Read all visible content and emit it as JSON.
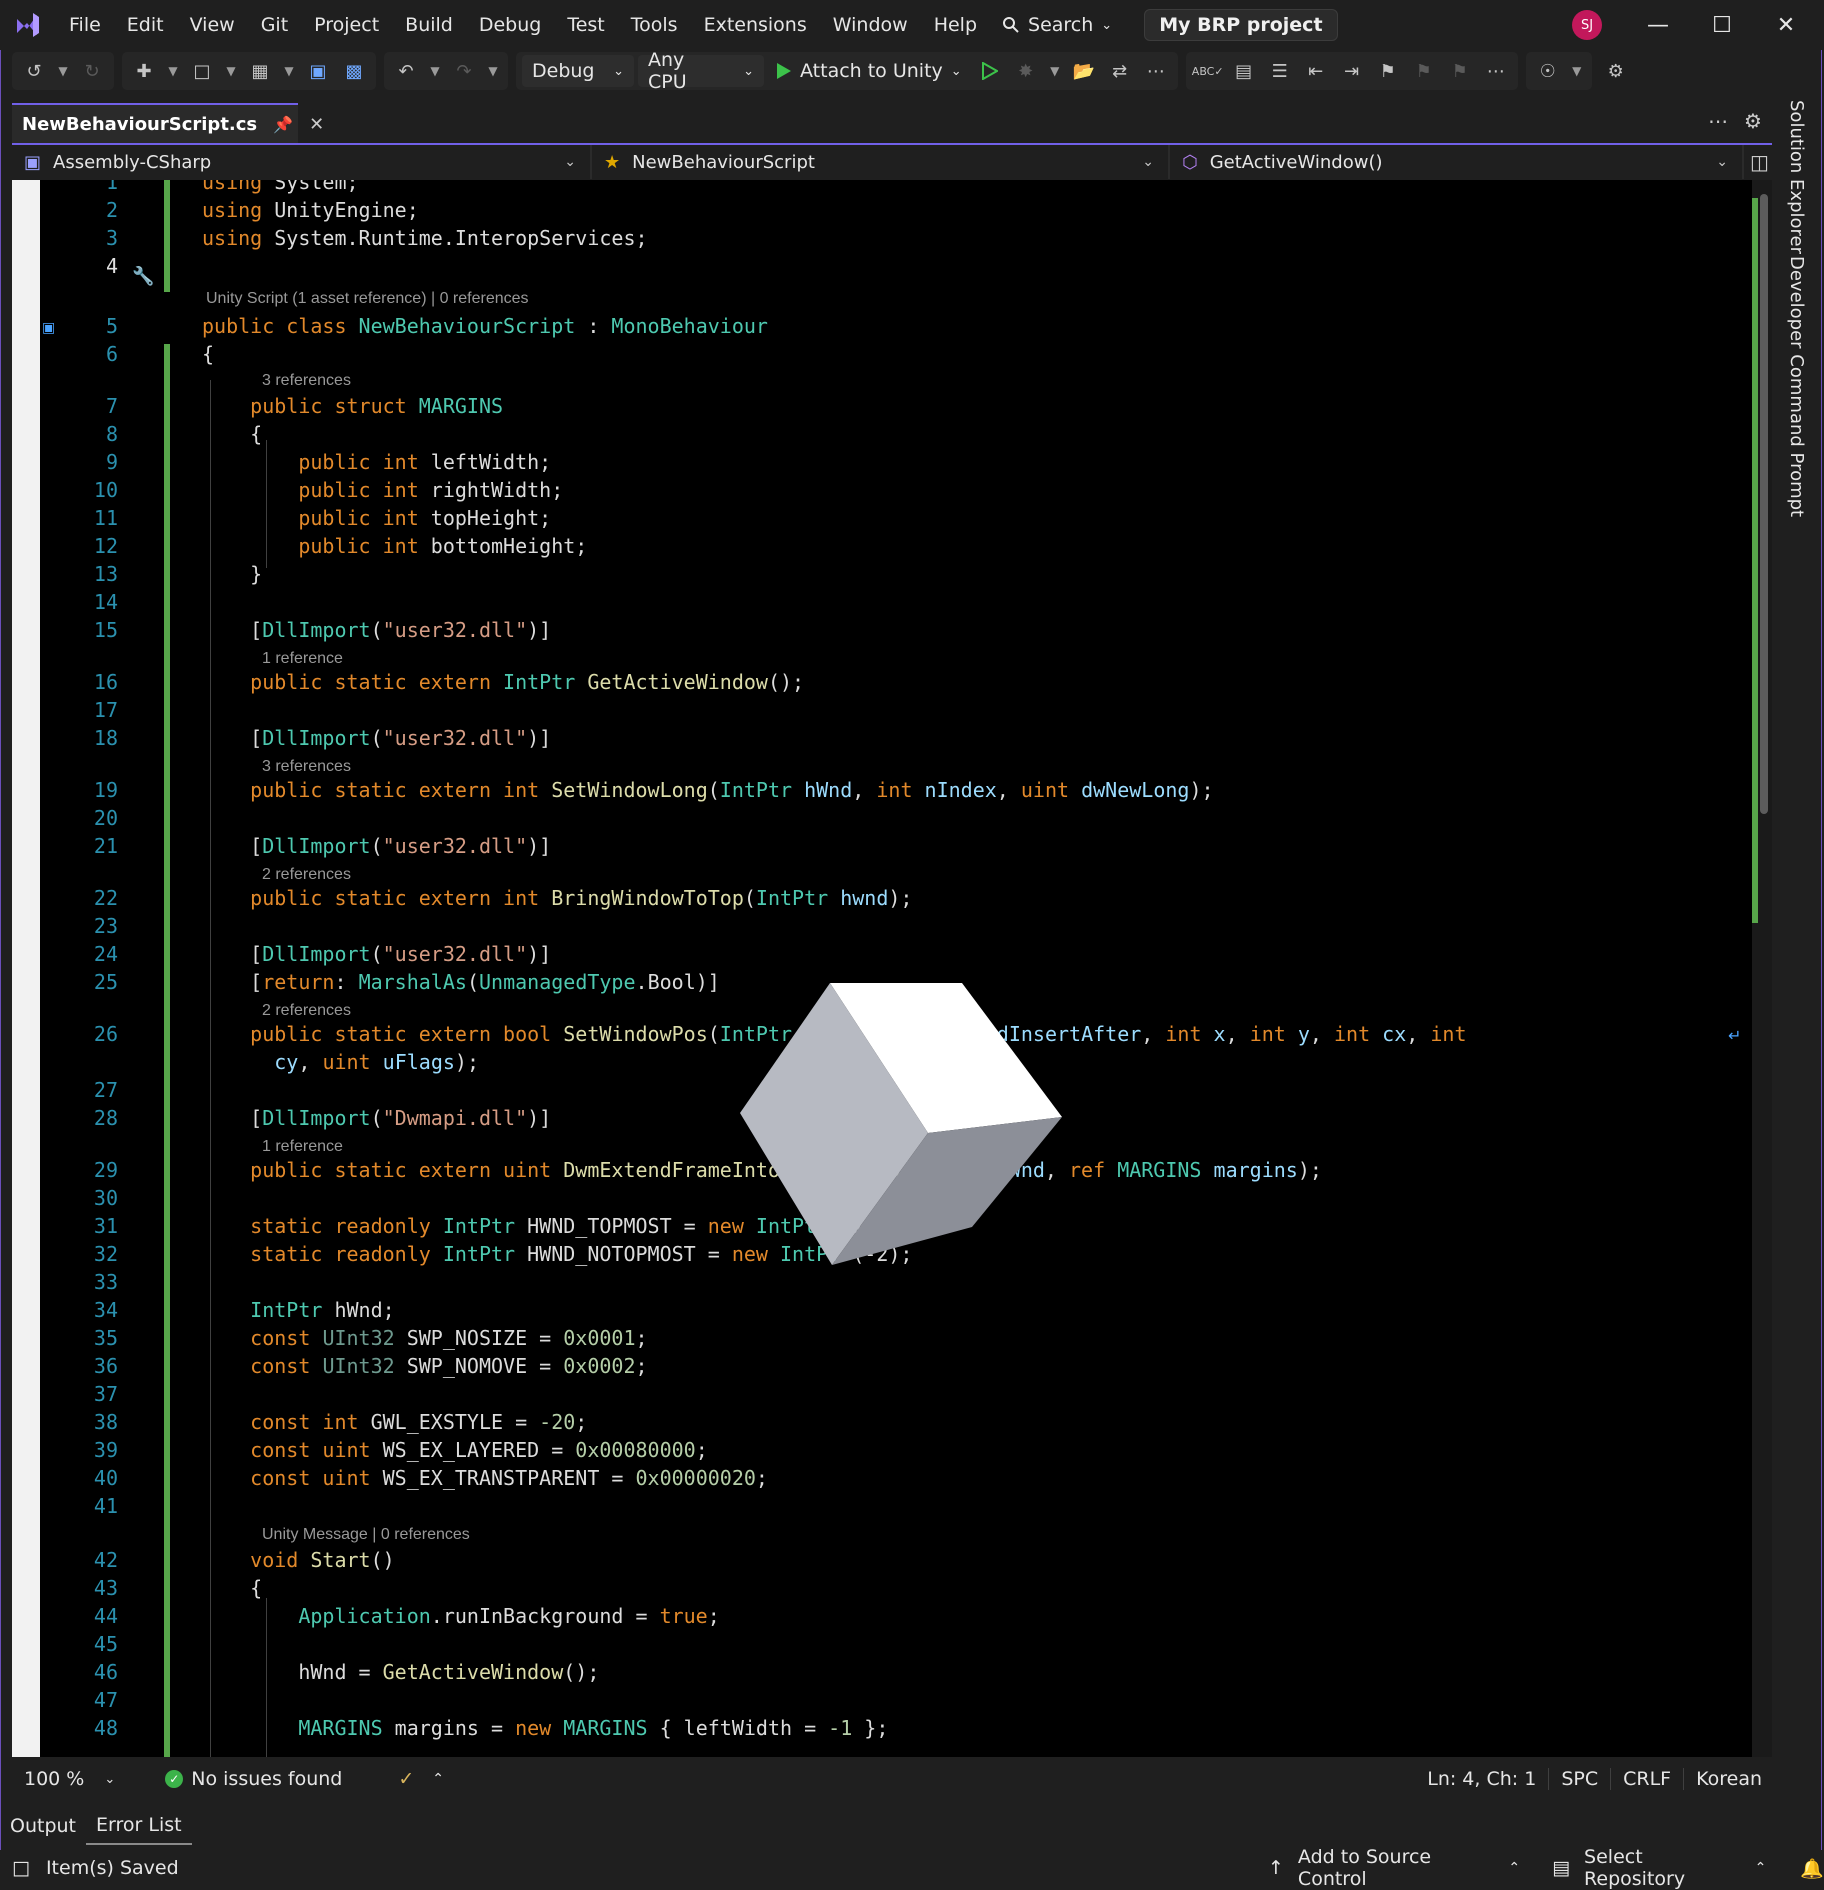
{
  "menu": {
    "items": [
      "File",
      "Edit",
      "View",
      "Git",
      "Project",
      "Build",
      "Debug",
      "Test",
      "Tools",
      "Extensions",
      "Window",
      "Help"
    ],
    "search_label": "Search",
    "project_title": "My BRP project",
    "avatar_initials": "SJ"
  },
  "toolbar": {
    "config": "Debug",
    "platform": "Any CPU",
    "attach_label": "Attach to Unity"
  },
  "tab": {
    "label": "NewBehaviourScript.cs"
  },
  "navbar": {
    "project": "Assembly-CSharp",
    "class": "NewBehaviourScript",
    "member": "GetActiveWindow()"
  },
  "codelens": {
    "l5": "Unity Script (1 asset reference) | 0 references",
    "l7": "3 references",
    "l16": "1 reference",
    "l19": "3 references",
    "l22": "2 references",
    "l26": "2 references",
    "l29": "1 reference",
    "l42": "Unity Message | 0 references"
  },
  "code_lines": [
    "using System;",
    "using UnityEngine;",
    "using System.Runtime.InteropServices;",
    "",
    "public class NewBehaviourScript : MonoBehaviour",
    "{",
    "    public struct MARGINS",
    "    {",
    "        public int leftWidth;",
    "        public int rightWidth;",
    "        public int topHeight;",
    "        public int bottomHeight;",
    "    }",
    "",
    "    [DllImport(\"user32.dll\")]",
    "    public static extern IntPtr GetActiveWindow();",
    "",
    "    [DllImport(\"user32.dll\")]",
    "    public static extern int SetWindowLong(IntPtr hWnd, int nIndex, uint dwNewLong);",
    "",
    "    [DllImport(\"user32.dll\")]",
    "    public static extern int BringWindowToTop(IntPtr hwnd);",
    "",
    "    [DllImport(\"user32.dll\")]",
    "    [return: MarshalAs(UnmanagedType.Bool)]",
    "    public static extern bool SetWindowPos(IntPtr hWnd, IntPtr hWndInsertAfter, int x, int y, int cx, int cy, uint uFlags);",
    "",
    "    [DllImport(\"Dwmapi.dll\")]",
    "    public static extern uint DwmExtendFrameIntoClientArea(IntPtr hWnd, ref MARGINS margins);",
    "",
    "    static readonly IntPtr HWND_TOPMOST = new IntPtr(-1);",
    "    static readonly IntPtr HWND_NOTOPMOST = new IntPtr(-2);",
    "",
    "    IntPtr hWnd;",
    "    const UInt32 SWP_NOSIZE = 0x0001;",
    "    const UInt32 SWP_NOMOVE = 0x0002;",
    "",
    "    const int GWL_EXSTYLE = -20;",
    "    const uint WS_EX_LAYERED = 0x00080000;",
    "    const uint WS_EX_TRANSTPARENT = 0x00000020;",
    "",
    "    void Start()",
    "    {",
    "        Application.runInBackground = true;",
    "",
    "        hWnd = GetActiveWindow();",
    "",
    "        MARGINS margins = new MARGINS { leftWidth = -1 };"
  ],
  "editor_status": {
    "zoom": "100 %",
    "issues": "No issues found",
    "position": "Ln: 4, Ch: 1",
    "whitespace": "SPC",
    "line_endings": "CRLF",
    "encoding": "Korean"
  },
  "side_tabs": [
    "Solution Explorer",
    "Developer Command Prompt"
  ],
  "bottom_tabs": [
    "Output",
    "Error List"
  ],
  "statusbar": {
    "message": "Item(s) Saved",
    "source_control": "Add to Source Control",
    "repository": "Select Repository"
  },
  "colors": {
    "accent": "#7160e8",
    "keyword": "#e2892b",
    "type": "#4ec9b0",
    "string": "#d69d85",
    "line_number": "#2b91af",
    "change_bar": "#57a64a"
  }
}
